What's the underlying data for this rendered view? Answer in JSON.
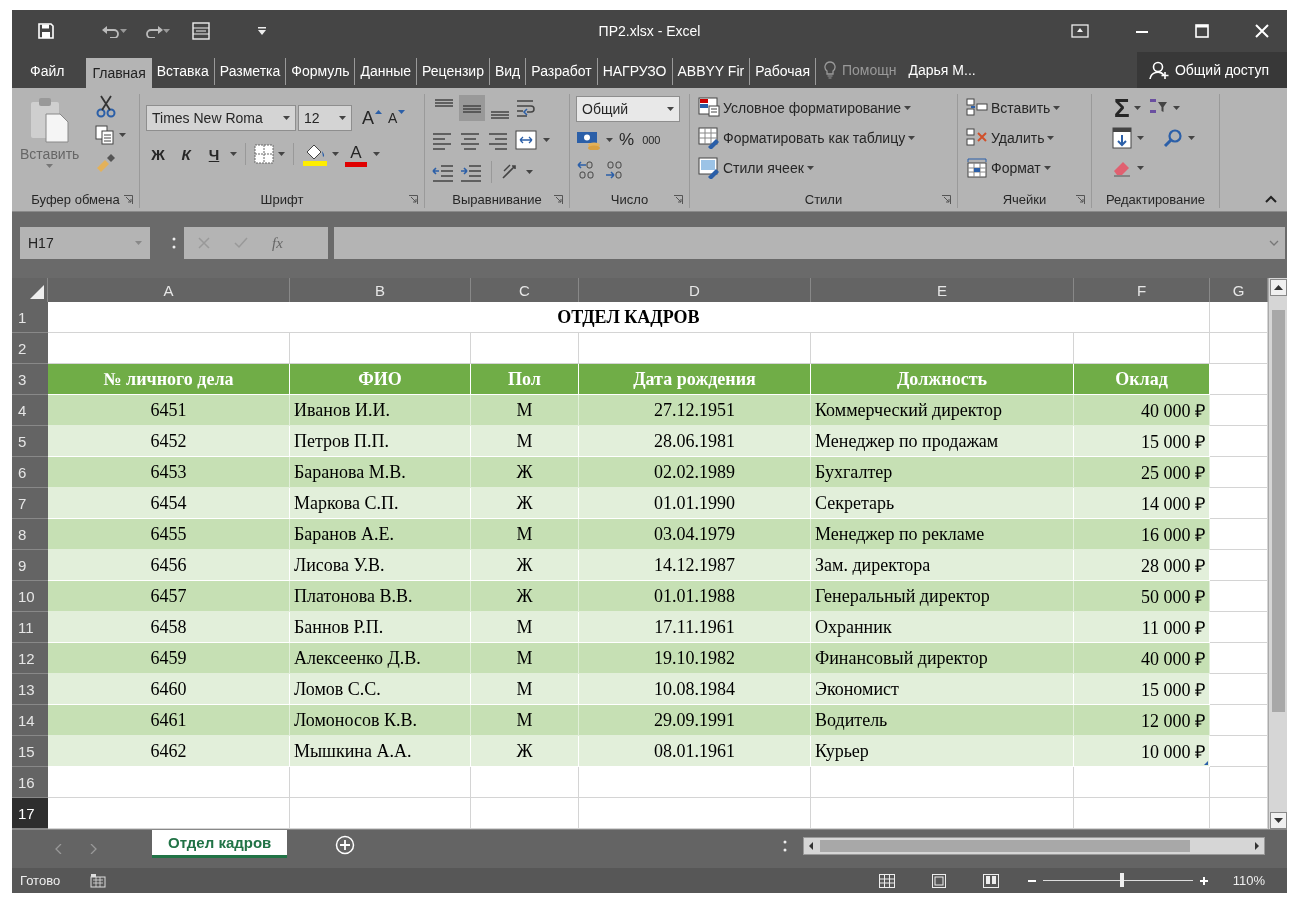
{
  "title_bar": {
    "title": "ПР2.xlsx - Excel"
  },
  "ribbon_tabs": [
    {
      "label": "Файл",
      "selected": false
    },
    {
      "label": "Главная",
      "selected": true
    },
    {
      "label": "Вставка",
      "selected": false
    },
    {
      "label": "Разметка",
      "selected": false
    },
    {
      "label": "Формуль",
      "selected": false
    },
    {
      "label": "Данные",
      "selected": false
    },
    {
      "label": "Рецензир",
      "selected": false
    },
    {
      "label": "Вид",
      "selected": false
    },
    {
      "label": "Разработ",
      "selected": false
    },
    {
      "label": "НАГРУЗО",
      "selected": false
    },
    {
      "label": "ABBYY Fir",
      "selected": false
    },
    {
      "label": "Рабочая",
      "selected": false
    }
  ],
  "tell_me": "Помощн",
  "user": "Дарья М...",
  "share": "Общий доступ",
  "ribbon": {
    "clipboard": {
      "paste": "Вставить",
      "label": "Буфер обмена"
    },
    "font": {
      "name": "Times New Roma",
      "size": "12",
      "grow": "A",
      "shrink": "A",
      "bold": "Ж",
      "italic": "К",
      "underline": "Ч",
      "font_color": "A",
      "label": "Шрифт"
    },
    "alignment": {
      "vertical_align": [
        {
          "selected": false
        },
        {
          "selected": true
        },
        {
          "selected": false
        }
      ],
      "label": "Выравнивание"
    },
    "number": {
      "format": "Общий",
      "percent": "%",
      "thousands": "000",
      "label": "Число"
    },
    "styles": {
      "items": [
        "Условное форматирование",
        "Форматировать как таблицу",
        "Стили ячеек"
      ],
      "label": "Стили"
    },
    "cells": {
      "items": [
        "Вставить",
        "Удалить",
        "Формат"
      ],
      "label": "Ячейки"
    },
    "editing": {
      "sum": "Σ",
      "label": "Редактирование"
    }
  },
  "formula_bar": {
    "name_box": "H17",
    "function_label": "fx"
  },
  "columns": [
    "A",
    "B",
    "C",
    "D",
    "E",
    "F",
    "G"
  ],
  "rows": [
    {
      "number": "1",
      "kind": "title",
      "selected": false,
      "cells": [
        "ОТДЕЛ КАДРОВ"
      ]
    },
    {
      "number": "2",
      "kind": "blank",
      "selected": false
    },
    {
      "number": "3",
      "kind": "header",
      "selected": false,
      "cells": [
        "№ личного дела",
        "ФИО",
        "Пол",
        "Дата рождения",
        "Должность",
        "Оклад"
      ]
    },
    {
      "number": "4",
      "kind": "data",
      "selected": false,
      "cells": [
        "6451",
        "Иванов И.И.",
        "М",
        "27.12.1951",
        "Коммерческий директор",
        "40 000 ₽"
      ]
    },
    {
      "number": "5",
      "kind": "data",
      "selected": false,
      "cells": [
        "6452",
        "Петров П.П.",
        "М",
        "28.06.1981",
        "Менеджер по продажам",
        "15 000 ₽"
      ]
    },
    {
      "number": "6",
      "kind": "data",
      "selected": false,
      "cells": [
        "6453",
        "Баранова М.В.",
        "Ж",
        "02.02.1989",
        "Бухгалтер",
        "25 000 ₽"
      ]
    },
    {
      "number": "7",
      "kind": "data",
      "selected": false,
      "cells": [
        "6454",
        "Маркова С.П.",
        "Ж",
        "01.01.1990",
        "Секретарь",
        "14 000 ₽"
      ]
    },
    {
      "number": "8",
      "kind": "data",
      "selected": false,
      "cells": [
        "6455",
        "Баранов А.Е.",
        "М",
        "03.04.1979",
        "Менеджер по рекламе",
        "16 000 ₽"
      ]
    },
    {
      "number": "9",
      "kind": "data",
      "selected": false,
      "cells": [
        "6456",
        "Лисова У.В.",
        "Ж",
        "14.12.1987",
        "Зам. директора",
        "28 000 ₽"
      ]
    },
    {
      "number": "10",
      "kind": "data",
      "selected": false,
      "cells": [
        "6457",
        "Платонова В.В.",
        "Ж",
        "01.01.1988",
        "Генеральный директор",
        "50 000 ₽"
      ]
    },
    {
      "number": "11",
      "kind": "data",
      "selected": false,
      "cells": [
        "6458",
        "Баннов Р.П.",
        "М",
        "17.11.1961",
        "Охранник",
        "11 000 ₽"
      ]
    },
    {
      "number": "12",
      "kind": "data",
      "selected": false,
      "cells": [
        "6459",
        "Алексеенко Д.В.",
        "М",
        "19.10.1982",
        "Финансовый директор",
        "40 000 ₽"
      ]
    },
    {
      "number": "13",
      "kind": "data",
      "selected": false,
      "cells": [
        "6460",
        "Ломов С.С.",
        "М",
        "10.08.1984",
        "Экономист",
        "15 000 ₽"
      ]
    },
    {
      "number": "14",
      "kind": "data",
      "selected": false,
      "cells": [
        "6461",
        "Ломоносов К.В.",
        "М",
        "29.09.1991",
        "Водитель",
        "12 000 ₽"
      ]
    },
    {
      "number": "15",
      "kind": "data",
      "selected": false,
      "cells": [
        "6462",
        "Мышкина А.А.",
        "Ж",
        "08.01.1961",
        "Курьер",
        "10 000 ₽"
      ]
    },
    {
      "number": "16",
      "kind": "blank",
      "selected": false
    },
    {
      "number": "17",
      "kind": "blank",
      "selected": true
    }
  ],
  "sheet_tabs": [
    {
      "label": "Отдел кадров",
      "selected": true
    }
  ],
  "status_bar": {
    "status": "Готово",
    "zoom_slider": {
      "level": 0.53
    },
    "zoom": "110%"
  }
}
